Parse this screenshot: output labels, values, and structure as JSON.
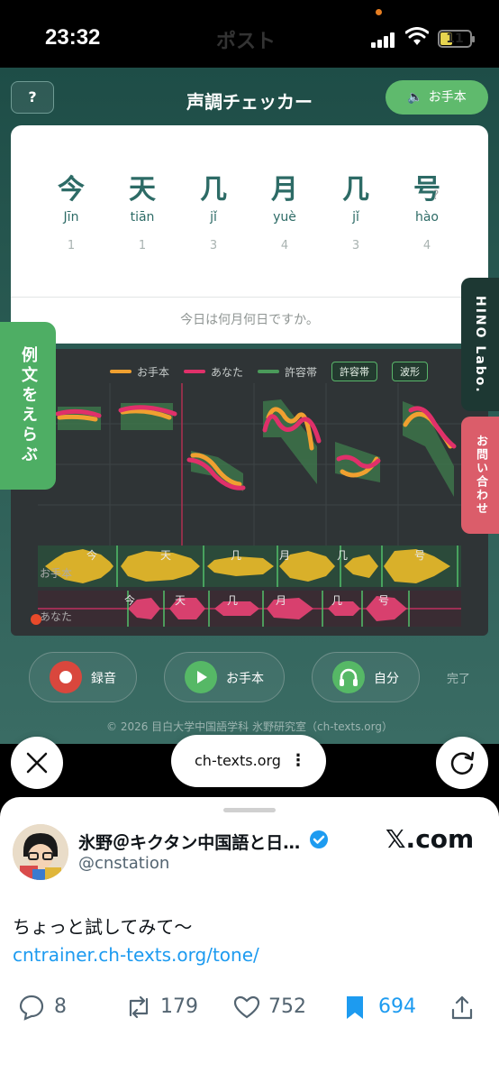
{
  "status": {
    "time": "23:32",
    "header_title": "ポスト",
    "battery": "11"
  },
  "app": {
    "help_label": "?",
    "title": "声調チェッカー",
    "model_button": "お手本",
    "sentence": [
      {
        "hanzi": "今",
        "pinyin": "Jīn",
        "tone": "1"
      },
      {
        "hanzi": "天",
        "pinyin": "tiān",
        "tone": "1"
      },
      {
        "hanzi": "几",
        "pinyin": "jǐ",
        "tone": "3"
      },
      {
        "hanzi": "月",
        "pinyin": "yuè",
        "tone": "4"
      },
      {
        "hanzi": "几",
        "pinyin": "jǐ",
        "tone": "3"
      },
      {
        "hanzi": "号",
        "pinyin": "hào",
        "tone": "4"
      }
    ],
    "question_mark": "?",
    "meaning": "今日は何月何日ですか。",
    "legend": {
      "model": "お手本",
      "you": "あなた",
      "band": "許容帯",
      "chip_band": "許容帯",
      "chip_wave": "波形"
    },
    "colors": {
      "model": "#f0a030",
      "you": "#e0306a",
      "band": "#4a9a5a"
    },
    "wave_labels": {
      "model": "お手本",
      "you": "あなた"
    },
    "segment_labels": [
      "今",
      "天",
      "几",
      "月",
      "几",
      "号"
    ],
    "left_tab": "例文をえらぶ",
    "hino_tab": "HINO Labo.",
    "contact_tab": "お問い合わせ",
    "controls": {
      "record": "録音",
      "model": "お手本",
      "self": "自分",
      "done": "完了"
    },
    "copyright": "© 2026 目白大学中国語学科 氷野研究室（ch-texts.org）"
  },
  "browser": {
    "url": "ch-texts.org",
    "more": "⋮"
  },
  "tweet": {
    "author": "氷野＠キクタン中国語と日…",
    "handle": "@cnstation",
    "brand": "𝕏.com",
    "text": "ちょっと試してみて〜",
    "link": "cntrainer.ch-texts.org/tone/",
    "replies": "8",
    "retweets": "179",
    "likes": "752",
    "bookmarks": "694"
  }
}
